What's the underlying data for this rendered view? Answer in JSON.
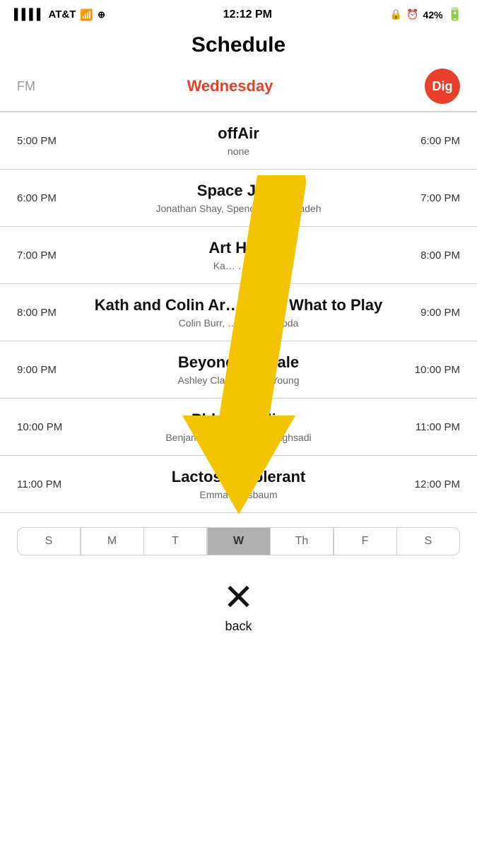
{
  "statusBar": {
    "carrier": "AT&T",
    "time": "12:12 PM",
    "battery": "42%"
  },
  "page": {
    "title": "Schedule"
  },
  "header": {
    "fm": "FM",
    "day": "Wednesday",
    "dig": "Dig"
  },
  "schedule": [
    {
      "timeLeft": "5:00 PM",
      "timeRight": "6:00 PM",
      "showTitle": "offAir",
      "showHosts": "none"
    },
    {
      "timeLeft": "6:00 PM",
      "timeRight": "7:00 PM",
      "showTitle": "Space Ja…",
      "showHosts": "Jonathan Shay, Spenc… Mehdizadeh"
    },
    {
      "timeLeft": "7:00 PM",
      "timeRight": "8:00 PM",
      "showTitle": "Art H…r",
      "showHosts": "Ka…         …aux"
    },
    {
      "timeLeft": "8:00 PM",
      "timeRight": "9:00 PM",
      "showTitle": "Kath and Colin Ar… …out What to Play",
      "showHosts": "Colin Burr, …herine Zmoda"
    },
    {
      "timeLeft": "9:00 PM",
      "timeRight": "10:00 PM",
      "showTitle": "Beyond the Pale",
      "showHosts": "Ashley Clarke, Kayla Young"
    },
    {
      "timeLeft": "10:00 PM",
      "timeRight": "11:00 PM",
      "showTitle": "Phlyte Radio",
      "showHosts": "Benjamin Crane, Noah Maghsadi"
    },
    {
      "timeLeft": "11:00 PM",
      "timeRight": "12:00 PM",
      "showTitle": "Lactose Intolerant",
      "showHosts": "Emma Weisbaum"
    }
  ],
  "days": [
    {
      "label": "S",
      "active": false
    },
    {
      "label": "M",
      "active": false
    },
    {
      "label": "T",
      "active": false
    },
    {
      "label": "W",
      "active": true
    },
    {
      "label": "Th",
      "active": false
    },
    {
      "label": "F",
      "active": false
    },
    {
      "label": "S",
      "active": false
    }
  ],
  "back": {
    "symbol": "✕",
    "label": "back"
  }
}
